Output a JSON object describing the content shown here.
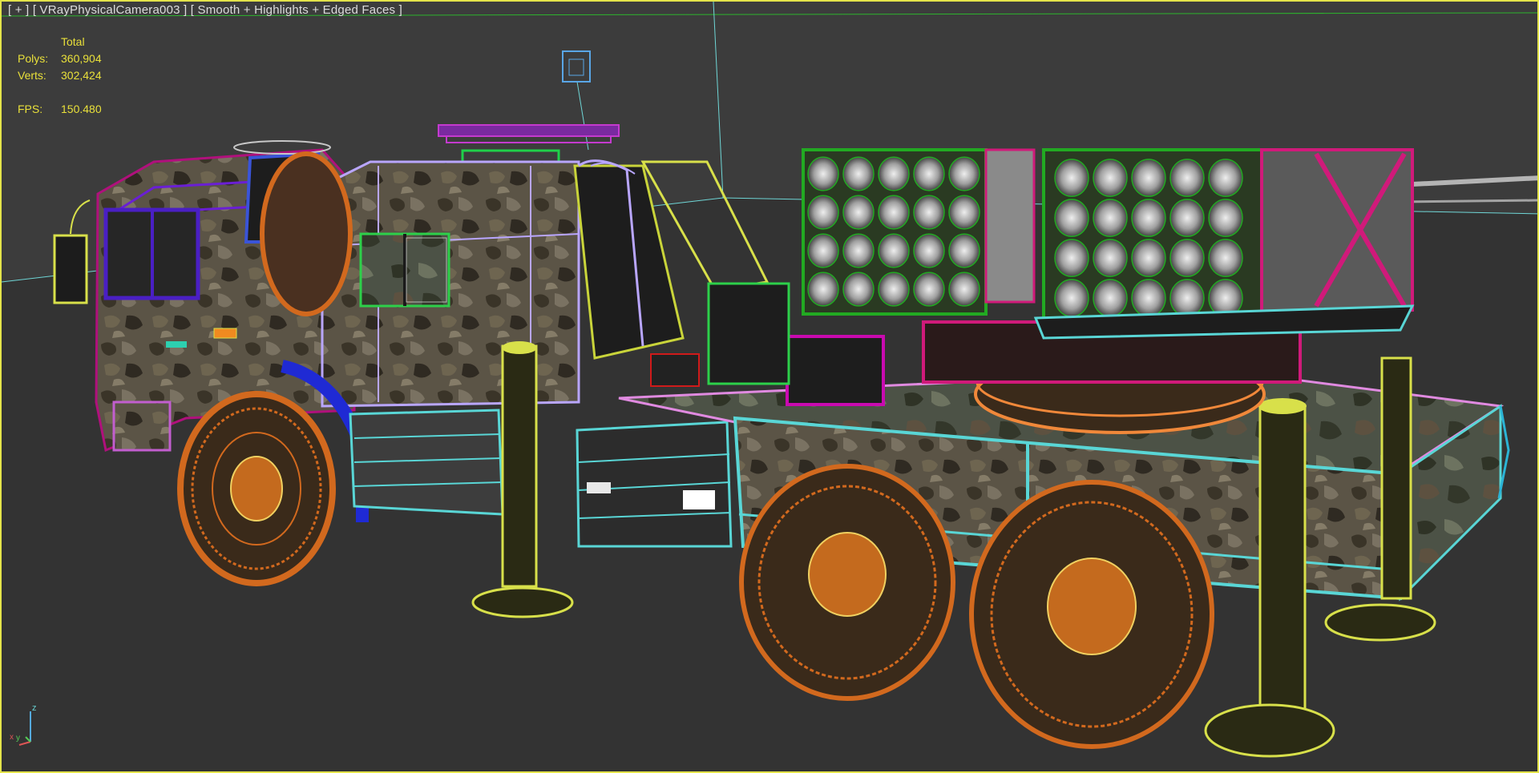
{
  "viewport": {
    "menu_label": "[ + ]",
    "camera_label": "[ VRayPhysicalCamera003 ]",
    "shading_label": "[ Smooth + Highlights + Edged Faces ]"
  },
  "stats": {
    "header": "Total",
    "polys_label": "Polys:",
    "polys_value": "360,904",
    "verts_label": "Verts:",
    "verts_value": "302,424",
    "fps_label": "FPS:",
    "fps_value": "150.480"
  },
  "gizmo": {
    "z": "z",
    "x": "x",
    "y": "y"
  },
  "colors": {
    "background": "#3c3c3c",
    "ground": "#333333",
    "border_active": "#e3e34a",
    "stats_text": "#e9e03a",
    "wire_orange": "#d2691e",
    "wire_green": "#22aa22",
    "wire_magenta": "#d01a7a",
    "wire_cyan": "#59d6d6",
    "wire_yellow": "#d8e04a",
    "wire_purple": "#8a4ae0",
    "wire_lilac": "#b9a6ff"
  }
}
